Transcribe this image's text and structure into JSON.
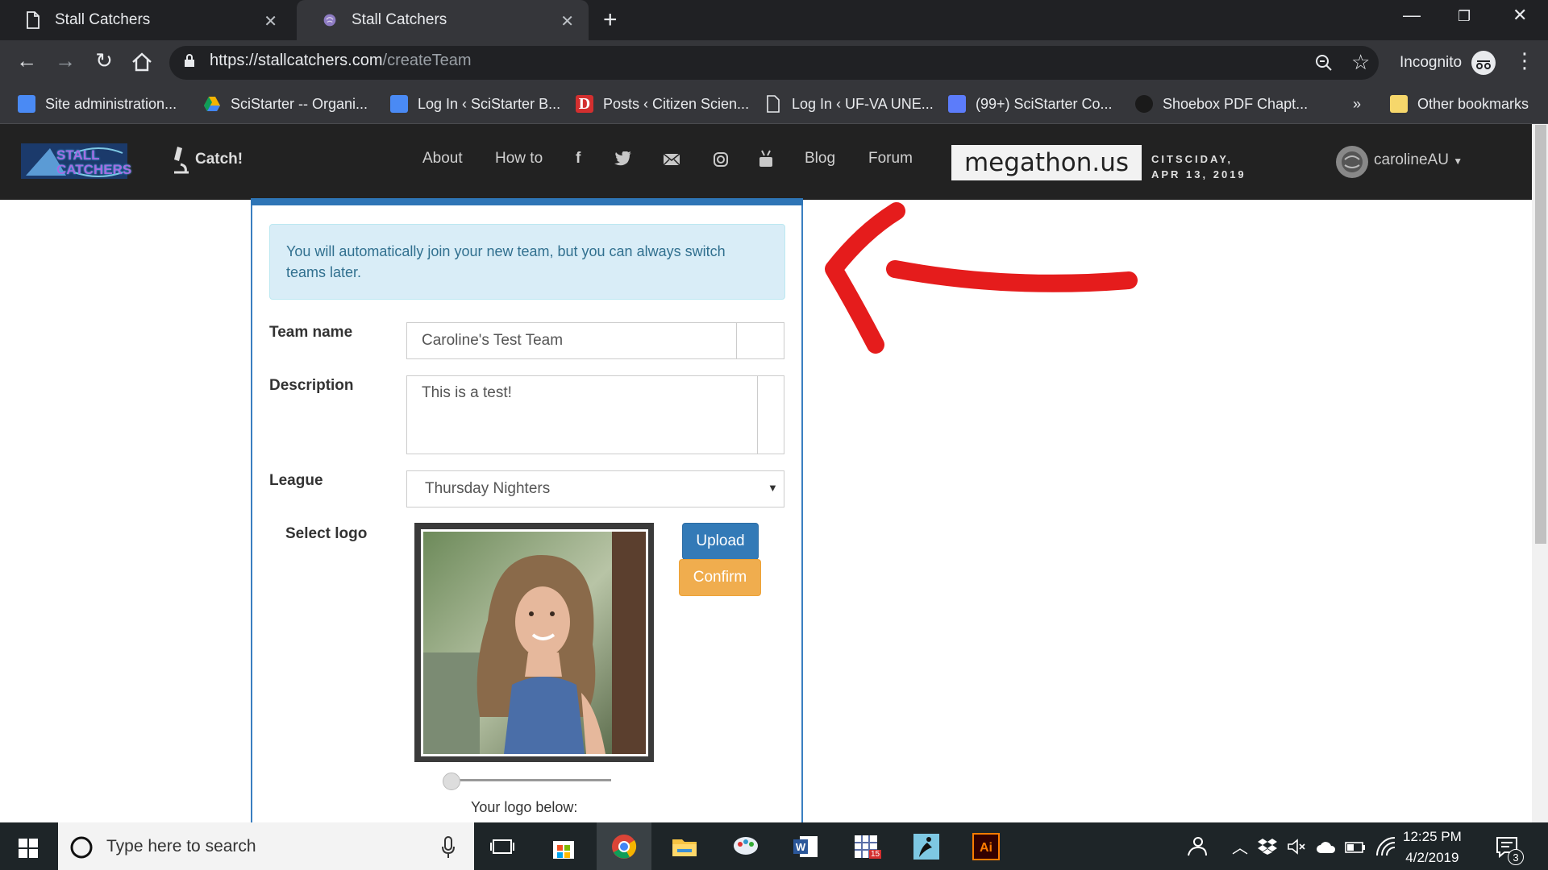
{
  "browser": {
    "tabs": [
      {
        "title": "Stall Catchers"
      },
      {
        "title": "Stall Catchers"
      }
    ],
    "url_domain": "https://stallcatchers.com",
    "url_path": "/createTeam",
    "profile_label": "Incognito",
    "bookmarks": [
      {
        "label": "Site administration...",
        "color": "#4a8af4"
      },
      {
        "label": "SciStarter -- Organi...",
        "color": "#f4b400"
      },
      {
        "label": "Log In ‹ SciStarter B...",
        "color": "#4a8af4"
      },
      {
        "label": "Posts ‹ Citizen Scien...",
        "color": "#d32f2f"
      },
      {
        "label": "Log In ‹ UF-VA UNE...",
        "color": "#9aa0a6"
      },
      {
        "label": "(99+) SciStarter Co...",
        "color": "#5c7cfa"
      },
      {
        "label": "Shoebox PDF Chapt...",
        "color": "#1a1a1a"
      }
    ],
    "overflow_label": "»",
    "other_bookmarks": "Other bookmarks"
  },
  "site": {
    "logo_text": "STALL CATCHERS",
    "catch_label": "Catch!",
    "nav": {
      "about": "About",
      "howto": "How to",
      "blog": "Blog",
      "forum": "Forum"
    },
    "banner": "megathon.us",
    "banner_sub1": "CITSCIDAY,",
    "banner_sub2": "APR 13, 2019",
    "username": "carolineAU"
  },
  "form": {
    "alert": "You will automatically join your new team, but you can always switch teams later.",
    "team_name_label": "Team name",
    "team_name_value": "Caroline's Test Team",
    "description_label": "Description",
    "description_value": "This is a test!",
    "league_label": "League",
    "league_value": "Thursday Nighters",
    "select_logo_label": "Select logo",
    "upload_label": "Upload",
    "confirm_label": "Confirm",
    "zoom_level": 0.0,
    "logo_below_label": "Your logo below:"
  },
  "taskbar": {
    "search_placeholder": "Type here to search",
    "time": "12:25 PM",
    "date": "4/2/2019",
    "notification_count": "3",
    "calendar_badge": "15"
  },
  "colors": {
    "accent_blue": "#2e75b6",
    "confirm_orange": "#f0ad4e",
    "annotation_red": "#e51c1c"
  }
}
